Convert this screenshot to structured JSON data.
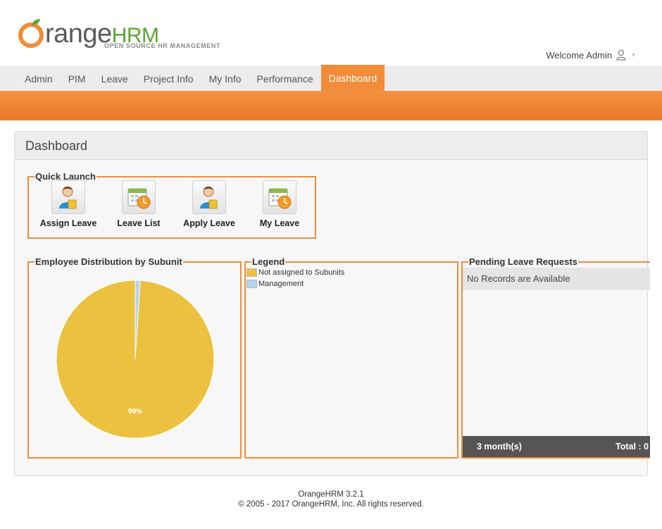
{
  "brand": {
    "name_part1": "range",
    "name_part2": "HRM",
    "tagline": "OPEN SOURCE HR MANAGEMENT"
  },
  "header": {
    "welcome": "Welcome Admin"
  },
  "nav": {
    "items": [
      "Admin",
      "PIM",
      "Leave",
      "Project Info",
      "My Info",
      "Performance",
      "Dashboard"
    ],
    "active": "Dashboard"
  },
  "panel": {
    "title": "Dashboard"
  },
  "quick_launch": {
    "title": "Quick Launch",
    "items": [
      {
        "label": "Assign Leave",
        "icon": "person-document-icon"
      },
      {
        "label": "Leave List",
        "icon": "calendar-clock-icon"
      },
      {
        "label": "Apply Leave",
        "icon": "person-document-icon"
      },
      {
        "label": "My Leave",
        "icon": "calendar-clock-icon"
      }
    ]
  },
  "distribution": {
    "title": "Employee Distribution by Subunit",
    "slice_label": "99%"
  },
  "legend": {
    "title": "Legend",
    "items": [
      {
        "label": "Not assigned to Subunits",
        "color": "#ebc13f"
      },
      {
        "label": "Management",
        "color": "#b2d5f0"
      }
    ]
  },
  "pending": {
    "title": "Pending Leave Requests",
    "empty_text": "No Records are Available",
    "period": "3 month(s)",
    "total": "Total : 0"
  },
  "footer": {
    "version": "OrangeHRM 3.2.1",
    "copyright": "© 2005 - 2017 OrangeHRM, Inc. All rights reserved."
  },
  "chart_data": {
    "type": "pie",
    "categories": [
      "Not assigned to Subunits",
      "Management"
    ],
    "values": [
      99,
      1
    ],
    "colors": [
      "#ebc13f",
      "#b2d5f0"
    ],
    "legend": "right"
  }
}
